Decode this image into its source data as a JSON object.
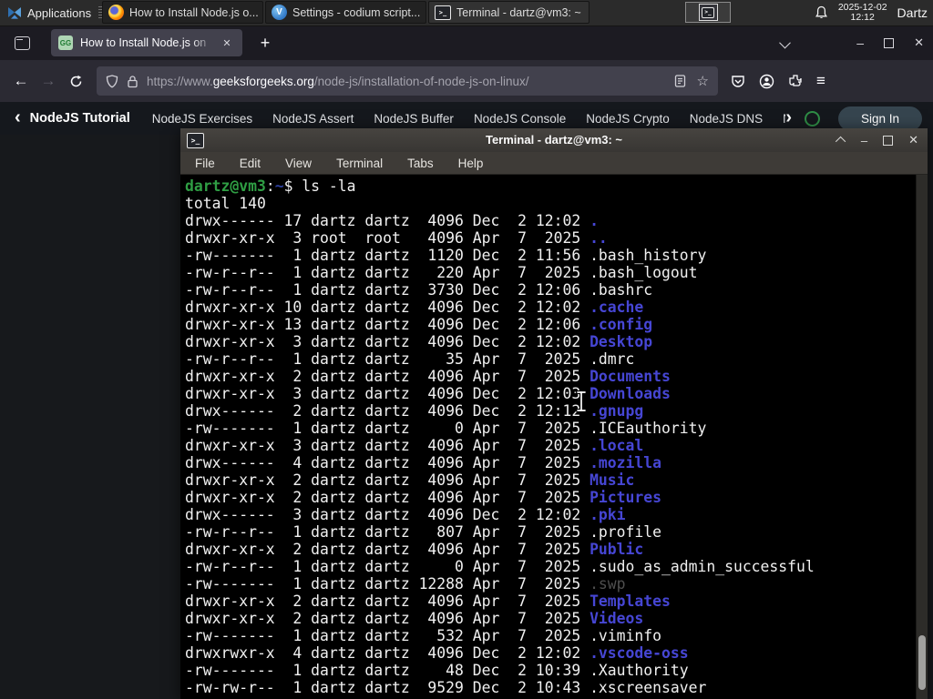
{
  "taskbar": {
    "applications_label": "Applications",
    "windows": [
      {
        "title": "How to Install Node.js o...",
        "icon": "firefox"
      },
      {
        "title": "Settings - codium script...",
        "icon": "codium"
      },
      {
        "title": "Terminal - dartz@vm3: ~",
        "icon": "terminal"
      }
    ],
    "clock_date": "2025-12-02",
    "clock_time": "12:12",
    "user": "Dartz"
  },
  "glyphs": {
    "back": "←",
    "forward": "→",
    "new_tab": "+",
    "minimize": "–",
    "close": "✕",
    "star": "☆",
    "hamburger": "≡",
    "nav_back_chevron": "‹",
    "nav_more_chevron": "›",
    "terminal_prompt_icon": ">_",
    "codium_letter": "V",
    "favicon_text": "GG"
  },
  "browser": {
    "tab": {
      "title": "How to Install Node.js on"
    },
    "urlbar": {
      "scheme": "https://www.",
      "domain": "geeksforgeeks.org",
      "path": "/node-js/installation-of-node-js-on-linux/"
    },
    "site_nav": {
      "back_label": "NodeJS Tutorial",
      "links": [
        "NodeJS Exercises",
        "NodeJS Assert",
        "NodeJS Buffer",
        "NodeJS Console",
        "NodeJS Crypto",
        "NodeJS DNS",
        "NodeJS Debugging"
      ],
      "sign_in_label": "Sign In",
      "accent_green": "#2f8d46"
    }
  },
  "terminal": {
    "title": "Terminal - dartz@vm3: ~",
    "menu": [
      "File",
      "Edit",
      "View",
      "Terminal",
      "Tabs",
      "Help"
    ],
    "colors": {
      "bg": "#000000",
      "fg": "#f0f0f0",
      "user": "#2f9e44",
      "path": "#2c3f9e",
      "dir": "#4646d4",
      "dim": "#4f4f4f"
    },
    "lines": [
      {
        "spans": [
          {
            "t": "dartz@vm3",
            "c": "user",
            "b": 1
          },
          {
            "t": ":",
            "c": "fg"
          },
          {
            "t": "~",
            "c": "path",
            "b": 1
          },
          {
            "t": "$ ls -la",
            "c": "fg"
          }
        ]
      },
      {
        "spans": [
          {
            "t": "total 140",
            "c": "fg"
          }
        ]
      },
      {
        "spans": [
          {
            "t": "drwx------ 17 dartz dartz  4096 Dec  2 12:02 ",
            "c": "fg"
          },
          {
            "t": ".",
            "c": "dir",
            "b": 1
          }
        ]
      },
      {
        "spans": [
          {
            "t": "drwxr-xr-x  3 root  root   4096 Apr  7  2025 ",
            "c": "fg"
          },
          {
            "t": "..",
            "c": "dir",
            "b": 1
          }
        ]
      },
      {
        "spans": [
          {
            "t": "-rw-------  1 dartz dartz  1120 Dec  2 11:56 ",
            "c": "fg"
          },
          {
            "t": ".bash_history",
            "c": "fg"
          }
        ]
      },
      {
        "spans": [
          {
            "t": "-rw-r--r--  1 dartz dartz   220 Apr  7  2025 ",
            "c": "fg"
          },
          {
            "t": ".bash_logout",
            "c": "fg"
          }
        ]
      },
      {
        "spans": [
          {
            "t": "-rw-r--r--  1 dartz dartz  3730 Dec  2 12:06 ",
            "c": "fg"
          },
          {
            "t": ".bashrc",
            "c": "fg"
          }
        ]
      },
      {
        "spans": [
          {
            "t": "drwxr-xr-x 10 dartz dartz  4096 Dec  2 12:02 ",
            "c": "fg"
          },
          {
            "t": ".cache",
            "c": "dir",
            "b": 1
          }
        ]
      },
      {
        "spans": [
          {
            "t": "drwxr-xr-x 13 dartz dartz  4096 Dec  2 12:06 ",
            "c": "fg"
          },
          {
            "t": ".config",
            "c": "dir",
            "b": 1
          }
        ]
      },
      {
        "spans": [
          {
            "t": "drwxr-xr-x  3 dartz dartz  4096 Dec  2 12:02 ",
            "c": "fg"
          },
          {
            "t": "Desktop",
            "c": "dir",
            "b": 1
          }
        ]
      },
      {
        "spans": [
          {
            "t": "-rw-r--r--  1 dartz dartz    35 Apr  7  2025 ",
            "c": "fg"
          },
          {
            "t": ".dmrc",
            "c": "fg"
          }
        ]
      },
      {
        "spans": [
          {
            "t": "drwxr-xr-x  2 dartz dartz  4096 Apr  7  2025 ",
            "c": "fg"
          },
          {
            "t": "Documents",
            "c": "dir",
            "b": 1
          }
        ]
      },
      {
        "spans": [
          {
            "t": "drwxr-xr-x  3 dartz dartz  4096 Dec  2 12:03 ",
            "c": "fg"
          },
          {
            "t": "Downloads",
            "c": "dir",
            "b": 1
          }
        ]
      },
      {
        "spans": [
          {
            "t": "drwx------  2 dartz dartz  4096 Dec  2 12:12 ",
            "c": "fg"
          },
          {
            "t": ".gnupg",
            "c": "dir",
            "b": 1
          }
        ]
      },
      {
        "spans": [
          {
            "t": "-rw-------  1 dartz dartz     0 Apr  7  2025 ",
            "c": "fg"
          },
          {
            "t": ".ICEauthority",
            "c": "fg"
          }
        ]
      },
      {
        "spans": [
          {
            "t": "drwxr-xr-x  3 dartz dartz  4096 Apr  7  2025 ",
            "c": "fg"
          },
          {
            "t": ".local",
            "c": "dir",
            "b": 1
          }
        ]
      },
      {
        "spans": [
          {
            "t": "drwx------  4 dartz dartz  4096 Apr  7  2025 ",
            "c": "fg"
          },
          {
            "t": ".mozilla",
            "c": "dir",
            "b": 1
          }
        ]
      },
      {
        "spans": [
          {
            "t": "drwxr-xr-x  2 dartz dartz  4096 Apr  7  2025 ",
            "c": "fg"
          },
          {
            "t": "Music",
            "c": "dir",
            "b": 1
          }
        ]
      },
      {
        "spans": [
          {
            "t": "drwxr-xr-x  2 dartz dartz  4096 Apr  7  2025 ",
            "c": "fg"
          },
          {
            "t": "Pictures",
            "c": "dir",
            "b": 1
          }
        ]
      },
      {
        "spans": [
          {
            "t": "drwx------  3 dartz dartz  4096 Dec  2 12:02 ",
            "c": "fg"
          },
          {
            "t": ".pki",
            "c": "dir",
            "b": 1
          }
        ]
      },
      {
        "spans": [
          {
            "t": "-rw-r--r--  1 dartz dartz   807 Apr  7  2025 ",
            "c": "fg"
          },
          {
            "t": ".profile",
            "c": "fg"
          }
        ]
      },
      {
        "spans": [
          {
            "t": "drwxr-xr-x  2 dartz dartz  4096 Apr  7  2025 ",
            "c": "fg"
          },
          {
            "t": "Public",
            "c": "dir",
            "b": 1
          }
        ]
      },
      {
        "spans": [
          {
            "t": "-rw-r--r--  1 dartz dartz     0 Apr  7  2025 ",
            "c": "fg"
          },
          {
            "t": ".sudo_as_admin_successful",
            "c": "fg"
          }
        ]
      },
      {
        "spans": [
          {
            "t": "-rw-------  1 dartz dartz 12288 Apr  7  2025 ",
            "c": "fg"
          },
          {
            "t": ".swp",
            "c": "dim"
          }
        ]
      },
      {
        "spans": [
          {
            "t": "drwxr-xr-x  2 dartz dartz  4096 Apr  7  2025 ",
            "c": "fg"
          },
          {
            "t": "Templates",
            "c": "dir",
            "b": 1
          }
        ]
      },
      {
        "spans": [
          {
            "t": "drwxr-xr-x  2 dartz dartz  4096 Apr  7  2025 ",
            "c": "fg"
          },
          {
            "t": "Videos",
            "c": "dir",
            "b": 1
          }
        ]
      },
      {
        "spans": [
          {
            "t": "-rw-------  1 dartz dartz   532 Apr  7  2025 ",
            "c": "fg"
          },
          {
            "t": ".viminfo",
            "c": "fg"
          }
        ]
      },
      {
        "spans": [
          {
            "t": "drwxrwxr-x  4 dartz dartz  4096 Dec  2 12:02 ",
            "c": "fg"
          },
          {
            "t": ".vscode-oss",
            "c": "dir",
            "b": 1
          }
        ]
      },
      {
        "spans": [
          {
            "t": "-rw-------  1 dartz dartz    48 Dec  2 10:39 ",
            "c": "fg"
          },
          {
            "t": ".Xauthority",
            "c": "fg"
          }
        ]
      },
      {
        "spans": [
          {
            "t": "-rw-rw-r--  1 dartz dartz  9529 Dec  2 10:43 ",
            "c": "fg"
          },
          {
            "t": ".xscreensaver",
            "c": "fg"
          }
        ]
      }
    ]
  }
}
